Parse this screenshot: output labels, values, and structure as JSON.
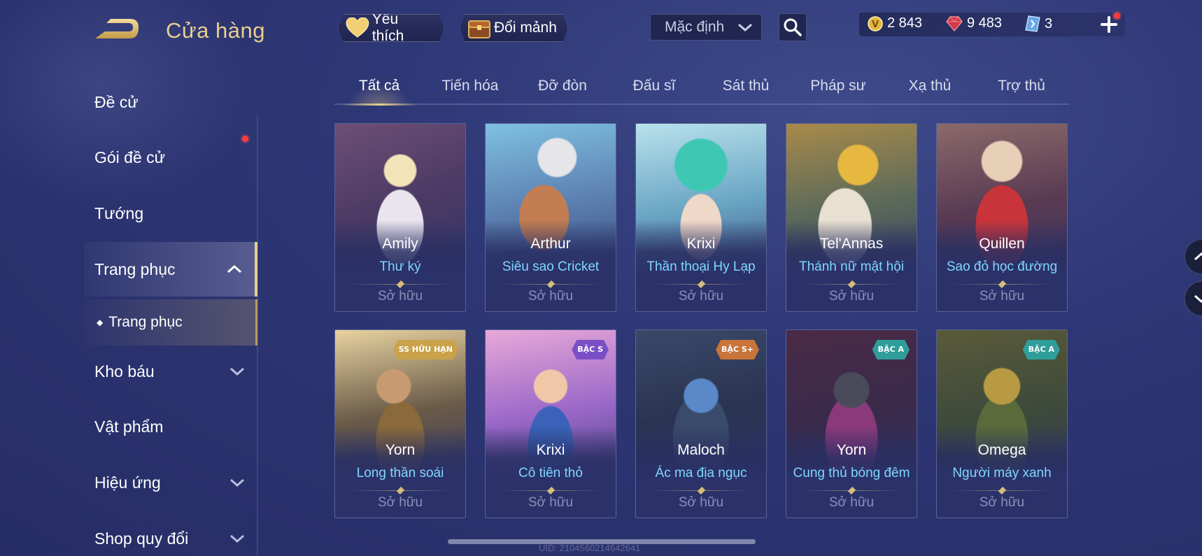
{
  "header": {
    "title": "Cửa hàng",
    "favorite_label": "Yêu thích",
    "swap_label": "Đổi mảnh",
    "sort_value": "Mặc định"
  },
  "currency": {
    "gold": "2 843",
    "ruby": "9 483",
    "voucher": "3"
  },
  "sidebar": {
    "items": [
      {
        "label": "Đề cử"
      },
      {
        "label": "Gói đề cử"
      },
      {
        "label": "Tướng"
      },
      {
        "label": "Trang phục"
      },
      {
        "label": "Kho báu"
      },
      {
        "label": "Vật phẩm"
      },
      {
        "label": "Hiệu ứng"
      },
      {
        "label": "Shop quy đổi"
      }
    ],
    "sub_item": "Trang phục"
  },
  "tabs": [
    {
      "label": "Tất cả"
    },
    {
      "label": "Tiến hóa"
    },
    {
      "label": "Đỡ đòn"
    },
    {
      "label": "Đấu sĩ"
    },
    {
      "label": "Sát thủ"
    },
    {
      "label": "Pháp sư"
    },
    {
      "label": "Xạ thủ"
    },
    {
      "label": "Trợ thủ"
    }
  ],
  "cards": [
    {
      "hero": "Amily",
      "skin": "Thư ký",
      "status": "Sở hữu",
      "badge": ""
    },
    {
      "hero": "Arthur",
      "skin": "Siêu sao Cricket",
      "status": "Sở hữu",
      "badge": ""
    },
    {
      "hero": "Krixi",
      "skin": "Thần thoại Hy Lạp",
      "status": "Sở hữu",
      "badge": ""
    },
    {
      "hero": "Tel'Annas",
      "skin": "Thánh nữ mật hội",
      "status": "Sở hữu",
      "badge": ""
    },
    {
      "hero": "Quillen",
      "skin": "Sao đỏ học đường",
      "status": "Sở hữu",
      "badge": ""
    },
    {
      "hero": "Yorn",
      "skin": "Long thần soái",
      "status": "Sở hữu",
      "badge": "SS HỮU HẠN"
    },
    {
      "hero": "Krixi",
      "skin": "Cô tiên thỏ",
      "status": "Sở hữu",
      "badge": "BẬC S"
    },
    {
      "hero": "Maloch",
      "skin": "Ác ma địa ngục",
      "status": "Sở hữu",
      "badge": "BẬC S+"
    },
    {
      "hero": "Yorn",
      "skin": "Cung thủ bóng đêm",
      "status": "Sở hữu",
      "badge": "BẬC A"
    },
    {
      "hero": "Omega",
      "skin": "Người máy xanh",
      "status": "Sở hữu",
      "badge": "BẬC A"
    }
  ],
  "footer": {
    "uid": "UID: 2104560214642641"
  },
  "colors": {
    "accent_gold": "#e8cf8e",
    "skin_name_blue": "#7fd6ff",
    "badge_ss": "#c9a24a",
    "badge_s": "#7a4fc6",
    "badge_s_plus": "#c8743a",
    "badge_a": "#2f9e9a"
  }
}
